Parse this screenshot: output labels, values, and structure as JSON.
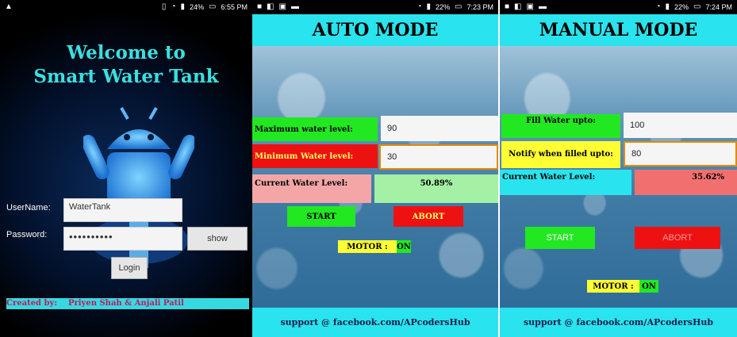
{
  "status_bars": [
    {
      "time": "6:55 PM",
      "battery": "24%"
    },
    {
      "time": "7:23 PM",
      "battery": "22%"
    },
    {
      "time": "7:24 PM",
      "battery": "22%"
    }
  ],
  "login": {
    "title_line1": "Welcome to",
    "title_line2": "Smart Water Tank",
    "username_label": "UserName:",
    "username_value": "WaterTank",
    "password_label": "Password:",
    "password_value": "••••••••••",
    "show_button": "show",
    "login_button": "Login",
    "credit": "Created by:    Priyen Shah & Anjali Patil"
  },
  "auto_mode": {
    "title": "AUTO MODE",
    "max_label": "Maximum water level:",
    "max_value": "90",
    "min_label": "Minimum Water level:",
    "min_value": "30",
    "current_label": "Current Water Level:",
    "current_value": "50.89%",
    "start_button": "START",
    "abort_button": "ABORT",
    "motor_label": "MOTOR :",
    "motor_state": "ON",
    "footer": "support @ facebook.com/APcodersHub"
  },
  "manual_mode": {
    "title": "MANUAL MODE",
    "fill_label": "Fill Water upto:",
    "fill_value": "100",
    "notify_label": "Notify when filled upto:",
    "notify_value": "80",
    "current_label": "Current Water Level:",
    "current_value": "35.62%",
    "start_button": "START",
    "abort_button": "ABORT",
    "motor_label": "MOTOR :",
    "motor_state": "ON",
    "footer": "support @ facebook.com/APcodersHub"
  },
  "colors": {
    "accent_cyan": "#29e4ee",
    "green": "#22e822",
    "red": "#ee1111",
    "pink": "#f4a6a6",
    "light_green": "#a4f0a4",
    "yellow": "#ffff33"
  }
}
